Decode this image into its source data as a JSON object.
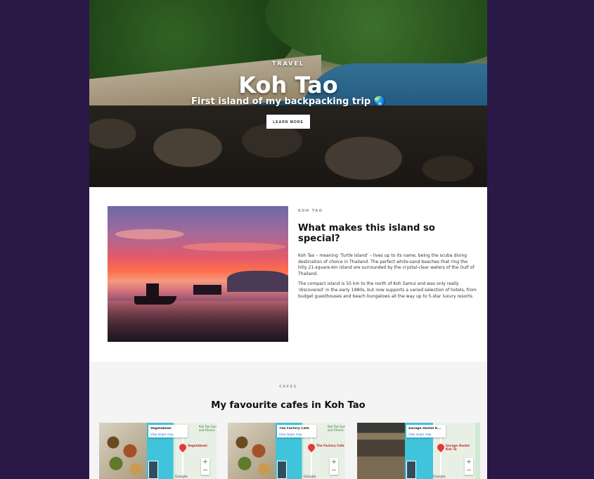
{
  "hero": {
    "eyebrow": "TRAVEL",
    "title": "Koh Tao",
    "subtitle": "First island of my backpacking trip 🌏",
    "button": "LEARN MORE"
  },
  "about": {
    "kicker": "KOH TAO",
    "title": "What makes this island so special?",
    "paragraphs": [
      "Koh Tao – meaning ‘Turtle Island’ – lives up to its name, being the scuba diving destination of choice in Thailand. The perfect white-sand beaches that ring the hilly 21-square-km island are surrounded by the crystal-clear waters of the Gulf of Thailand.",
      "The compact island is 55 km to the north of Koh Samui and was only really ‘discovered’ in the early 1980s, but now supports a varied selection of hotels, from budget guesthouses and beach bungalows all the way up to 5-star luxury resorts."
    ]
  },
  "cafes": {
    "kicker": "CAFES",
    "title": "My favourite cafes in Koh Tao",
    "items": [
      {
        "name": "Vegetabowl",
        "link": "View larger map",
        "pin": "Vegetabowl",
        "side": "Koh Tao Gym and Fitness"
      },
      {
        "name": "The Factory Cafe",
        "link": "View larger map",
        "pin": "The Factory Cafe",
        "side": "Koh Tao Gym and Fitness"
      },
      {
        "name": "Savage Hostel K...",
        "link": "View larger map",
        "pin": "Savage Hostel Koh Ta",
        "side": ""
      }
    ],
    "zoom_in": "+",
    "zoom_out": "−",
    "google": "Google"
  }
}
